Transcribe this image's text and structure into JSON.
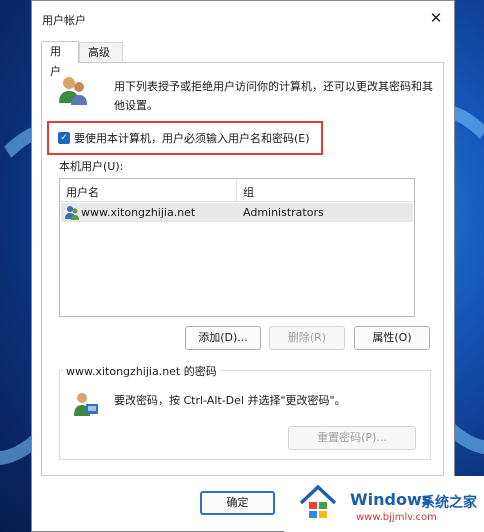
{
  "dialog": {
    "title": "用户帐户",
    "close_glyph": "✕",
    "tabs": [
      {
        "label": "用户",
        "active": true
      },
      {
        "label": "高级",
        "active": false
      }
    ],
    "description": "用下列表授予或拒绝用户访问你的计算机，还可以更改其密码和其他设置。",
    "require_login_checkbox": {
      "checked": true,
      "label": "要使用本计算机，用户必须输入用户名和密码(E)"
    },
    "local_users_label": "本机用户(U):",
    "table": {
      "columns": [
        "用户名",
        "组"
      ],
      "rows": [
        {
          "user": "www.xitongzhijia.net",
          "group": "Administrators",
          "selected": true
        }
      ]
    },
    "buttons": {
      "add": "添加(D)...",
      "remove": "删除(R)",
      "properties": "属性(O)"
    },
    "password_group": {
      "title": "www.xitongzhijia.net 的密码",
      "text": "要改密码，按 Ctrl-Alt-Del 并选择\"更改密码\"。",
      "reset_button": "重置密码(P)..."
    },
    "ok_button": "确定"
  },
  "watermark": {
    "brand": "Windows",
    "brand_cn": "系统之家",
    "url": "www.bjjmlv.com"
  },
  "colors": {
    "accent": "#1f66c1",
    "highlight_border": "#e23b3b",
    "brand": "#1b5fae"
  }
}
